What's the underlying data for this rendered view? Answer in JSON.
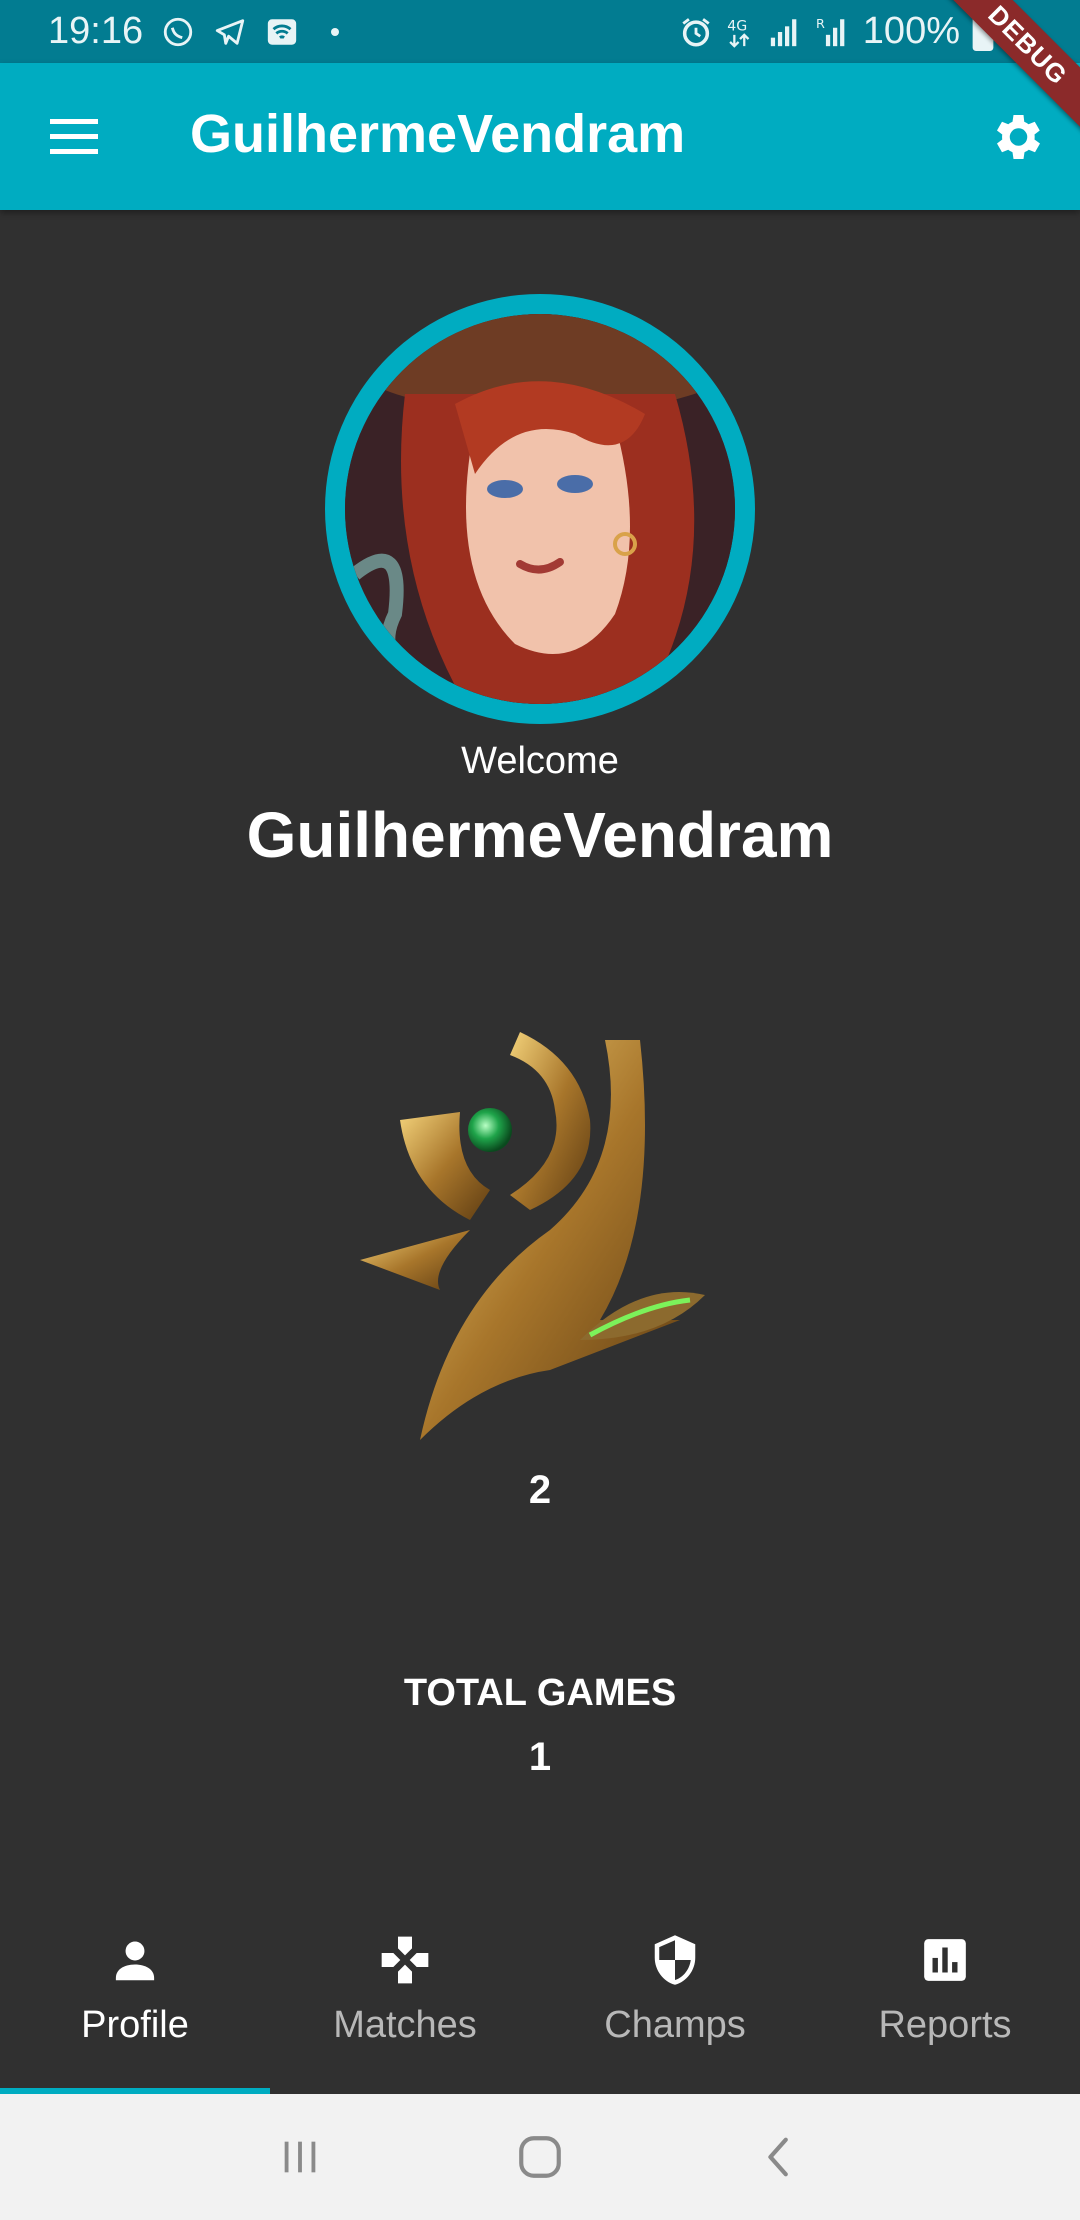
{
  "status_bar": {
    "time": "19:16",
    "battery": "100%",
    "icons": [
      "whatsapp-icon",
      "telegram-icon",
      "wifi-calling-icon",
      "alarm-icon",
      "4g-icon",
      "signal-icon",
      "signal-r-icon",
      "battery-icon"
    ]
  },
  "app_bar": {
    "title": "GuilhermeVendram",
    "menu_icon": "menu-icon",
    "settings_icon": "settings-gear-icon",
    "debug_banner": "DEBUG"
  },
  "profile": {
    "welcome": "Welcome",
    "username": "GuilhermeVendram",
    "mastery_value": "2",
    "total_games_label": "TOTAL GAMES",
    "total_games_value": "1"
  },
  "bottom_nav": {
    "tabs": [
      {
        "label": "Profile",
        "icon": "person-icon",
        "active": true
      },
      {
        "label": "Matches",
        "icon": "gamepad-icon",
        "active": false
      },
      {
        "label": "Champs",
        "icon": "shield-icon",
        "active": false
      },
      {
        "label": "Reports",
        "icon": "bar-chart-icon",
        "active": false
      }
    ]
  },
  "colors": {
    "accent": "#00acc1",
    "status_bar": "#027c91",
    "background": "#303030",
    "inactive_label": "#b8b8b8",
    "debug_banner": "#8b2a2a"
  }
}
